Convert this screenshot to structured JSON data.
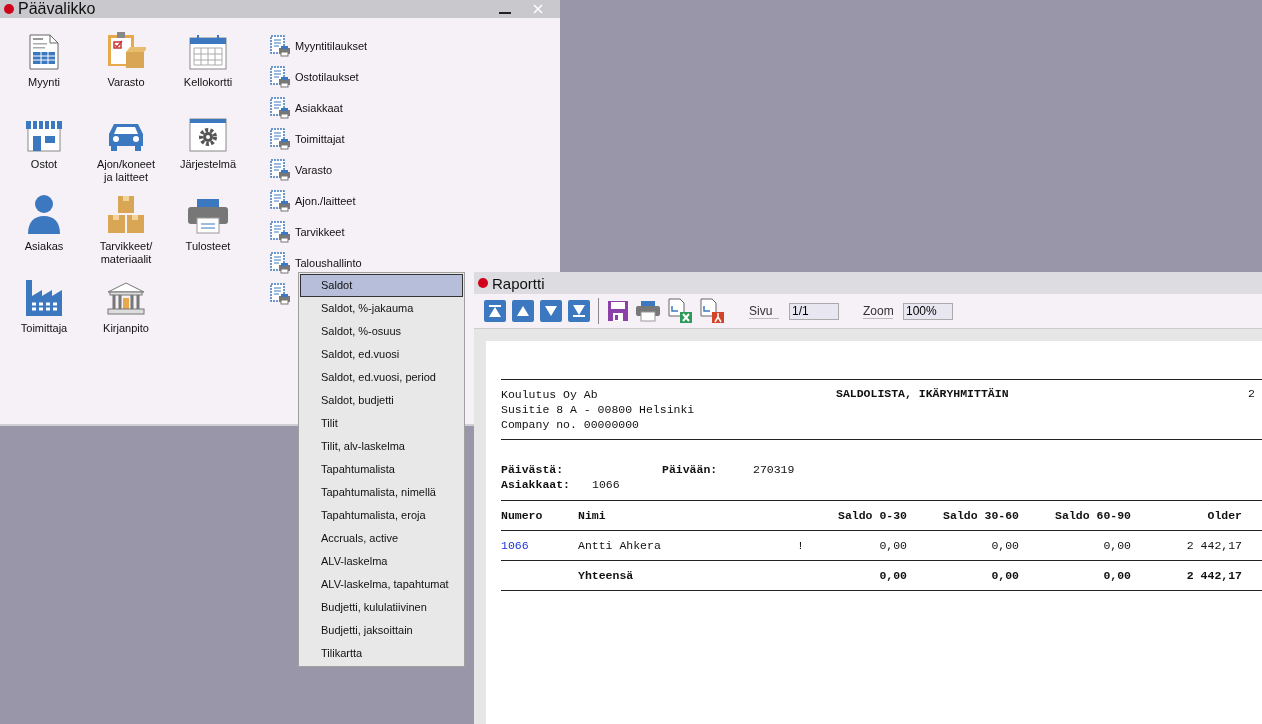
{
  "main_window": {
    "title": "Päävalikko",
    "modules": [
      {
        "label": "Myynti",
        "kind": "order"
      },
      {
        "label": "Varasto",
        "kind": "clipboard"
      },
      {
        "label": "Kellokortti",
        "kind": "calendar"
      },
      {
        "label": "Ostot",
        "kind": "store"
      },
      {
        "label": "Ajon/koneet ja laitteet",
        "kind": "car"
      },
      {
        "label": "Järjestelmä",
        "kind": "gear"
      },
      {
        "label": "Asiakas",
        "kind": "person"
      },
      {
        "label": "Tarvikkeet/ materiaalit",
        "kind": "boxes"
      },
      {
        "label": "Tulosteet",
        "kind": "printer"
      },
      {
        "label": "Toimittaja",
        "kind": "factory"
      },
      {
        "label": "Kirjanpito",
        "kind": "bank"
      }
    ],
    "reports": [
      {
        "label": "Myyntitilaukset"
      },
      {
        "label": "Ostotilaukset"
      },
      {
        "label": "Asiakkaat"
      },
      {
        "label": "Toimittajat"
      },
      {
        "label": "Varasto"
      },
      {
        "label": "Ajon./laitteet"
      },
      {
        "label": "Tarvikkeet"
      },
      {
        "label": "Taloushallinto"
      },
      {
        "kind": "report"
      }
    ]
  },
  "context_menu": [
    {
      "label": "Saldot",
      "selected": true
    },
    {
      "label": "Saldot, %-jakauma",
      "selected": false
    },
    {
      "label": "Saldot, %-osuus",
      "selected": false
    },
    {
      "label": "Saldot, ed.vuosi",
      "selected": false
    },
    {
      "label": "Saldot, ed.vuosi, period",
      "selected": false
    },
    {
      "label": "Saldot, budjetti",
      "selected": false
    },
    {
      "label": "Tilit",
      "selected": false
    },
    {
      "label": "Tilit, alv-laskelma",
      "selected": false
    },
    {
      "label": "Tapahtumalista",
      "selected": false
    },
    {
      "label": "Tapahtumalista, nimellä",
      "selected": false
    },
    {
      "label": "Tapahtumalista, eroja",
      "selected": false
    },
    {
      "label": "Accruals, active",
      "selected": false
    },
    {
      "label": "ALV-laskelma",
      "selected": false
    },
    {
      "label": "ALV-laskelma, tapahtumat",
      "selected": false
    },
    {
      "label": "Budjetti, kululatiivinen",
      "selected": false
    },
    {
      "label": "Budjetti, jaksoittain",
      "selected": false
    },
    {
      "label": "Tilikartta",
      "selected": false
    }
  ],
  "report_window": {
    "title": "Raportti",
    "toolbar": [
      {
        "kind": "first"
      },
      {
        "kind": "up"
      },
      {
        "kind": "down"
      },
      {
        "kind": "last"
      },
      {
        "kind": "save"
      },
      {
        "kind": "print"
      },
      {
        "kind": "excel"
      },
      {
        "kind": "pdf"
      }
    ],
    "page_label": "Sivu",
    "page_value": "1/1",
    "zoom_label": "Zoom",
    "zoom_value": "100%",
    "document": {
      "company_lines": [
        "Koulutus Oy Ab",
        "Susitie 8 A - 00800 Helsinki",
        "Company no. 00000000"
      ],
      "title": "SALDOLISTA, IKÄRYHMITTÄIN",
      "page_number": "2",
      "from_label": "Päivästä:",
      "to_label": "Päivään:",
      "to_value": "270319",
      "customers_label": "Asiakkaat:",
      "customers_value": "1066",
      "columns": [
        "Numero",
        "Nimi",
        null,
        "Saldo 0-30",
        "Saldo 30-60",
        "Saldo 60-90",
        "Older"
      ],
      "rows": [
        [
          "1066",
          "Antti Ahkera",
          "!",
          "0,00",
          "0,00",
          "0,00",
          "2 442,17"
        ]
      ],
      "total": {
        "label": "Yhteensä",
        "values": [
          "0,00",
          "0,00",
          "0,00",
          "2 442,17"
        ]
      }
    }
  }
}
